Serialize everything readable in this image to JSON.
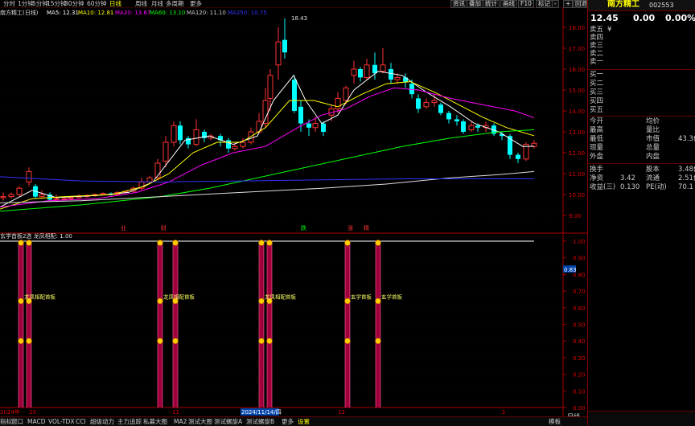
{
  "toolbar": {
    "periods": [
      "分时",
      "1分钟",
      "5分钟",
      "15分钟",
      "30分钟",
      "60分钟",
      "日线",
      "周线",
      "月线",
      "多周期",
      "更多"
    ],
    "active_period": "日线",
    "right_buttons": [
      "资讯",
      "叠加",
      "统计",
      "画线",
      "F10",
      "标记",
      "-",
      "+",
      "回退"
    ]
  },
  "chart": {
    "stock_label": "南方精工(日线)",
    "ma_legend": [
      {
        "label": "MA5: 12.31",
        "color": "#ffffff"
      },
      {
        "label": "MA10: 12.81",
        "color": "#ffff00"
      },
      {
        "label": "MA20: 13.67",
        "color": "#ff00ff"
      },
      {
        "label": "MA60: 13.10",
        "color": "#00ff00"
      },
      {
        "label": "MA120: 11.10",
        "color": "#cccccc"
      },
      {
        "label": "MA250: 10.75",
        "color": "#3333ff"
      }
    ],
    "price_axis": [
      "18.00",
      "17.00",
      "16.00",
      "15.00",
      "14.00",
      "13.00",
      "12.00",
      "11.00",
      "10.00",
      "9.00"
    ],
    "high_label": "18.43",
    "event_markers": [
      "业",
      "财",
      "跌",
      "涨",
      "精"
    ],
    "indicator_title": "玄学首板2选 龙凤相配: 1.00",
    "indicator_axis": [
      "1.00",
      "0.90",
      "0.80",
      "0.70",
      "0.60",
      "0.50",
      "0.40",
      "0.30",
      "0.20",
      "0.10",
      "0.00"
    ],
    "indicator_cursor": "0.83",
    "signal_labels": [
      "龙凤相配首板",
      "龙凤相配首板",
      "龙凤相配首板",
      "玄学首板",
      "玄学首板"
    ],
    "date_labels": [
      "2024年",
      "10",
      "11",
      "2024/11/14/四",
      "12",
      "1"
    ]
  },
  "quote": {
    "name": "南方精工",
    "code": "002553",
    "price": "12.45",
    "change": "0.00",
    "pct": "0.00%",
    "asks": [
      "卖五",
      "卖四",
      "卖三",
      "卖二",
      "卖一"
    ],
    "ask_extra": "¥",
    "bids": [
      "买一",
      "买二",
      "买三",
      "买四",
      "买五"
    ],
    "stats": [
      {
        "l": "今开",
        "r": "均价",
        "v2": ""
      },
      {
        "l": "最高",
        "r": "量比",
        "v2": ""
      },
      {
        "l": "最低",
        "r": "市值",
        "v2": "43.3亿"
      },
      {
        "l": "现量",
        "r": "总量",
        "v2": ""
      },
      {
        "l": "外盘",
        "r": "内盘",
        "v2": ""
      }
    ],
    "stats2": [
      {
        "l": "换手",
        "v": "",
        "r": "股本",
        "v2": "3.48亿"
      },
      {
        "l": "净资",
        "v": "3.42",
        "r": "流通",
        "v2": "2.51亿"
      },
      {
        "l": "收益(三)",
        "v": "0.130",
        "r": "PE(动)",
        "v2": "70.1"
      }
    ],
    "bottom_button": "日线"
  },
  "bottom_tabs": [
    "指标",
    "窗口",
    "MACD",
    "VOL-TDX",
    "CCI",
    "超级动力",
    "主力追踪",
    "私募大图",
    "MA2",
    "测试大图",
    "测试螺旋A",
    "测试螺旋B",
    "更多",
    "设置"
  ],
  "bottom_selected": "设置",
  "bottom_right": "模板"
}
